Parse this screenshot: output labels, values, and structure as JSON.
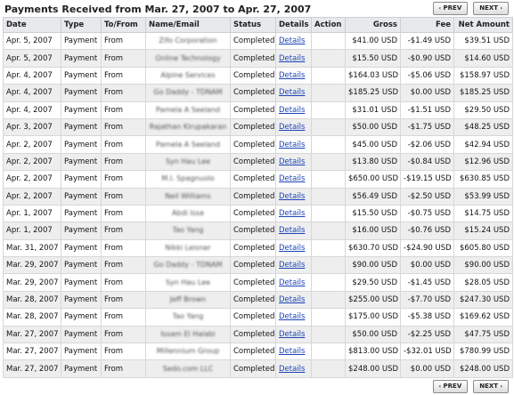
{
  "page": {
    "title": "Payments Received from Mar. 27, 2007 to Apr. 27, 2007",
    "prev_label": "PREV",
    "next_label": "NEXT",
    "prev_arrow": "‹",
    "next_arrow": "›"
  },
  "table": {
    "headers": {
      "date": "Date",
      "type": "Type",
      "tofrom": "To/From",
      "name": "Name/Email",
      "status": "Status",
      "details": "Details",
      "action": "Action",
      "gross": "Gross",
      "fee": "Fee",
      "net": "Net Amount"
    },
    "rows": [
      {
        "date": "Apr. 5, 2007",
        "type": "Payment",
        "tofrom": "From",
        "name": "Zifo Corporation",
        "status": "Completed",
        "details": "Details",
        "gross": "$41.00 USD",
        "fee": "-$1.49 USD",
        "net": "$39.51 USD"
      },
      {
        "date": "Apr. 5, 2007",
        "type": "Payment",
        "tofrom": "From",
        "name": "Online Technology",
        "status": "Completed",
        "details": "Details",
        "gross": "$15.50 USD",
        "fee": "-$0.90 USD",
        "net": "$14.60 USD"
      },
      {
        "date": "Apr. 4, 2007",
        "type": "Payment",
        "tofrom": "From",
        "name": "Alpine Services",
        "status": "Completed",
        "details": "Details",
        "gross": "$164.03 USD",
        "fee": "-$5.06 USD",
        "net": "$158.97 USD"
      },
      {
        "date": "Apr. 4, 2007",
        "type": "Payment",
        "tofrom": "From",
        "name": "Go Daddy - TDNAM",
        "status": "Completed",
        "details": "Details",
        "gross": "$185.25 USD",
        "fee": "$0.00 USD",
        "net": "$185.25 USD"
      },
      {
        "date": "Apr. 4, 2007",
        "type": "Payment",
        "tofrom": "From",
        "name": "Pamela A Seeland",
        "status": "Completed",
        "details": "Details",
        "gross": "$31.01 USD",
        "fee": "-$1.51 USD",
        "net": "$29.50 USD"
      },
      {
        "date": "Apr. 3, 2007",
        "type": "Payment",
        "tofrom": "From",
        "name": "Rajathan Kirupakaran",
        "status": "Completed",
        "details": "Details",
        "gross": "$50.00 USD",
        "fee": "-$1.75 USD",
        "net": "$48.25 USD"
      },
      {
        "date": "Apr. 2, 2007",
        "type": "Payment",
        "tofrom": "From",
        "name": "Pamela A Seeland",
        "status": "Completed",
        "details": "Details",
        "gross": "$45.00 USD",
        "fee": "-$2.06 USD",
        "net": "$42.94 USD"
      },
      {
        "date": "Apr. 2, 2007",
        "type": "Payment",
        "tofrom": "From",
        "name": "Syn Hau Lee",
        "status": "Completed",
        "details": "Details",
        "gross": "$13.80 USD",
        "fee": "-$0.84 USD",
        "net": "$12.96 USD"
      },
      {
        "date": "Apr. 2, 2007",
        "type": "Payment",
        "tofrom": "From",
        "name": "M.I. Spagnuolo",
        "status": "Completed",
        "details": "Details",
        "gross": "$650.00 USD",
        "fee": "-$19.15 USD",
        "net": "$630.85 USD"
      },
      {
        "date": "Apr. 2, 2007",
        "type": "Payment",
        "tofrom": "From",
        "name": "Neil Williams",
        "status": "Completed",
        "details": "Details",
        "gross": "$56.49 USD",
        "fee": "-$2.50 USD",
        "net": "$53.99 USD"
      },
      {
        "date": "Apr. 1, 2007",
        "type": "Payment",
        "tofrom": "From",
        "name": "Abdi Isse",
        "status": "Completed",
        "details": "Details",
        "gross": "$15.50 USD",
        "fee": "-$0.75 USD",
        "net": "$14.75 USD"
      },
      {
        "date": "Apr. 1, 2007",
        "type": "Payment",
        "tofrom": "From",
        "name": "Tao Yang",
        "status": "Completed",
        "details": "Details",
        "gross": "$16.00 USD",
        "fee": "-$0.76 USD",
        "net": "$15.24 USD"
      },
      {
        "date": "Mar. 31, 2007",
        "type": "Payment",
        "tofrom": "From",
        "name": "Nikki Leisner",
        "status": "Completed",
        "details": "Details",
        "gross": "$630.70 USD",
        "fee": "-$24.90 USD",
        "net": "$605.80 USD"
      },
      {
        "date": "Mar. 29, 2007",
        "type": "Payment",
        "tofrom": "From",
        "name": "Go Daddy - TDNAM",
        "status": "Completed",
        "details": "Details",
        "gross": "$90.00 USD",
        "fee": "$0.00 USD",
        "net": "$90.00 USD"
      },
      {
        "date": "Mar. 29, 2007",
        "type": "Payment",
        "tofrom": "From",
        "name": "Syn Hau Lee",
        "status": "Completed",
        "details": "Details",
        "gross": "$29.50 USD",
        "fee": "-$1.45 USD",
        "net": "$28.05 USD"
      },
      {
        "date": "Mar. 28, 2007",
        "type": "Payment",
        "tofrom": "From",
        "name": "Jeff Brown",
        "status": "Completed",
        "details": "Details",
        "gross": "$255.00 USD",
        "fee": "-$7.70 USD",
        "net": "$247.30 USD"
      },
      {
        "date": "Mar. 28, 2007",
        "type": "Payment",
        "tofrom": "From",
        "name": "Tao Yang",
        "status": "Completed",
        "details": "Details",
        "gross": "$175.00 USD",
        "fee": "-$5.38 USD",
        "net": "$169.62 USD"
      },
      {
        "date": "Mar. 27, 2007",
        "type": "Payment",
        "tofrom": "From",
        "name": "Issam El Halabi",
        "status": "Completed",
        "details": "Details",
        "gross": "$50.00 USD",
        "fee": "-$2.25 USD",
        "net": "$47.75 USD"
      },
      {
        "date": "Mar. 27, 2007",
        "type": "Payment",
        "tofrom": "From",
        "name": "Millennium Group",
        "status": "Completed",
        "details": "Details",
        "gross": "$813.00 USD",
        "fee": "-$32.01 USD",
        "net": "$780.99 USD"
      },
      {
        "date": "Mar. 27, 2007",
        "type": "Payment",
        "tofrom": "From",
        "name": "Sedo.com LLC",
        "status": "Completed",
        "details": "Details",
        "gross": "$248.00 USD",
        "fee": "$0.00 USD",
        "net": "$248.00 USD"
      }
    ]
  }
}
